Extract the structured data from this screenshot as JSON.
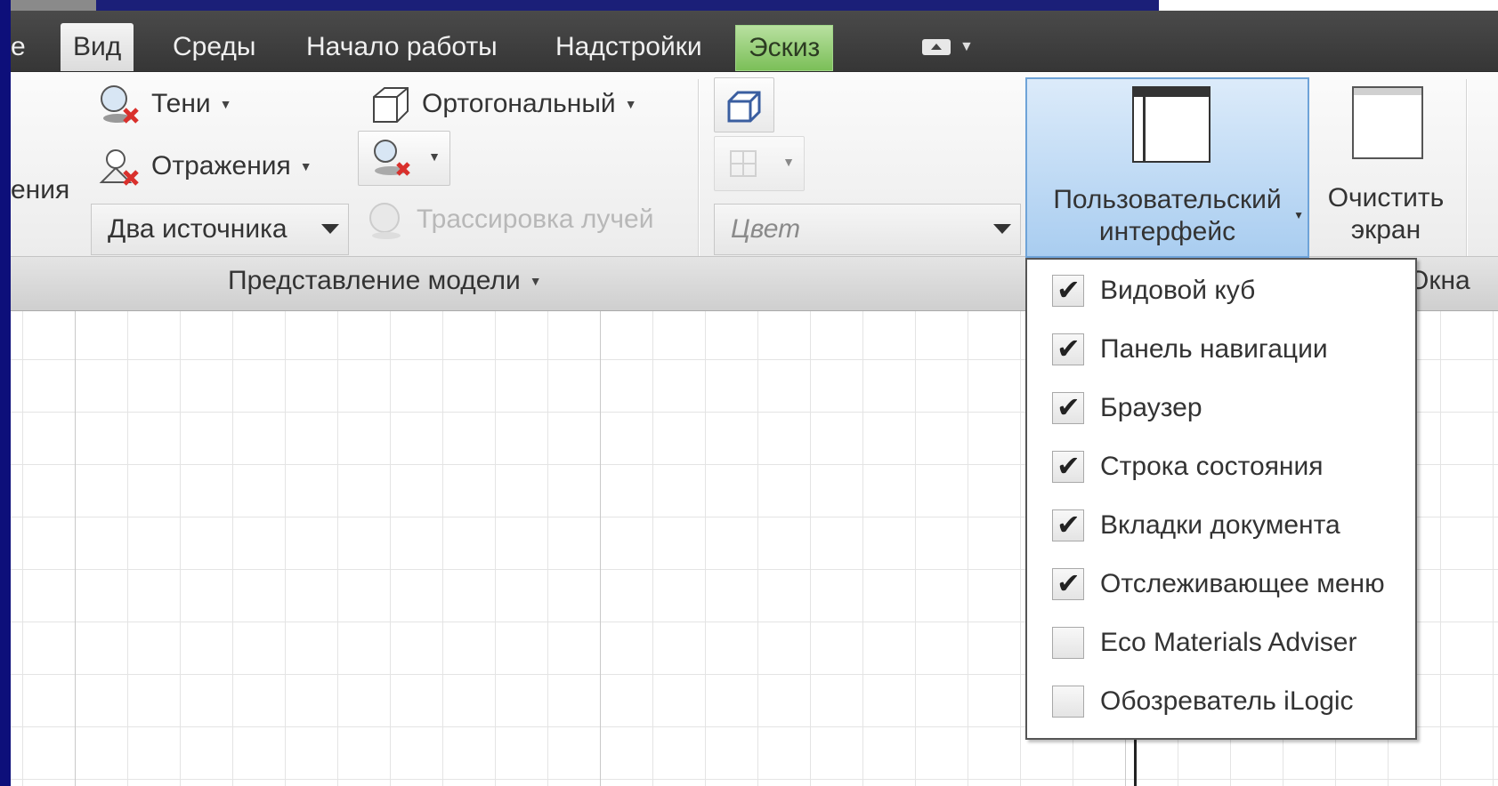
{
  "tabs": [
    {
      "label": "е",
      "state": "partial"
    },
    {
      "label": "Вид",
      "state": "active"
    },
    {
      "label": "Среды",
      "state": "normal"
    },
    {
      "label": "Начало работы",
      "state": "normal"
    },
    {
      "label": "Надстройки",
      "state": "normal"
    },
    {
      "label": "Эскиз",
      "state": "contextual"
    }
  ],
  "ribbon": {
    "partial_label": "ения",
    "shadows": "Тени",
    "reflections": "Отражения",
    "lighting_combo": "Два источника",
    "orthographic": "Ортогональный",
    "ray_tracing": "Трассировка лучей",
    "color_combo": "Цвет",
    "panel_title": "Представление модели",
    "windows_panel_partial": "Окна",
    "user_interface_line1": "Пользовательский",
    "user_interface_line2": "интерфейс",
    "clear_screen_line1": "Очистить",
    "clear_screen_line2": "экран"
  },
  "menu": {
    "items": [
      {
        "label": "Видовой куб",
        "checked": true
      },
      {
        "label": "Панель навигации",
        "checked": true
      },
      {
        "label": "Браузер",
        "checked": true
      },
      {
        "label": "Строка состояния",
        "checked": true
      },
      {
        "label": "Вкладки документа",
        "checked": true
      },
      {
        "label": "Отслеживающее меню",
        "checked": true
      },
      {
        "label": "Eco Materials Adviser",
        "checked": false
      },
      {
        "label": "Обозреватель iLogic",
        "checked": false
      }
    ],
    "check_glyph": "✔"
  },
  "colors": {
    "accent_blue": "#a9cdf0",
    "contextual_green": "#7bbf58",
    "outer_background": "#0d0f7a"
  }
}
